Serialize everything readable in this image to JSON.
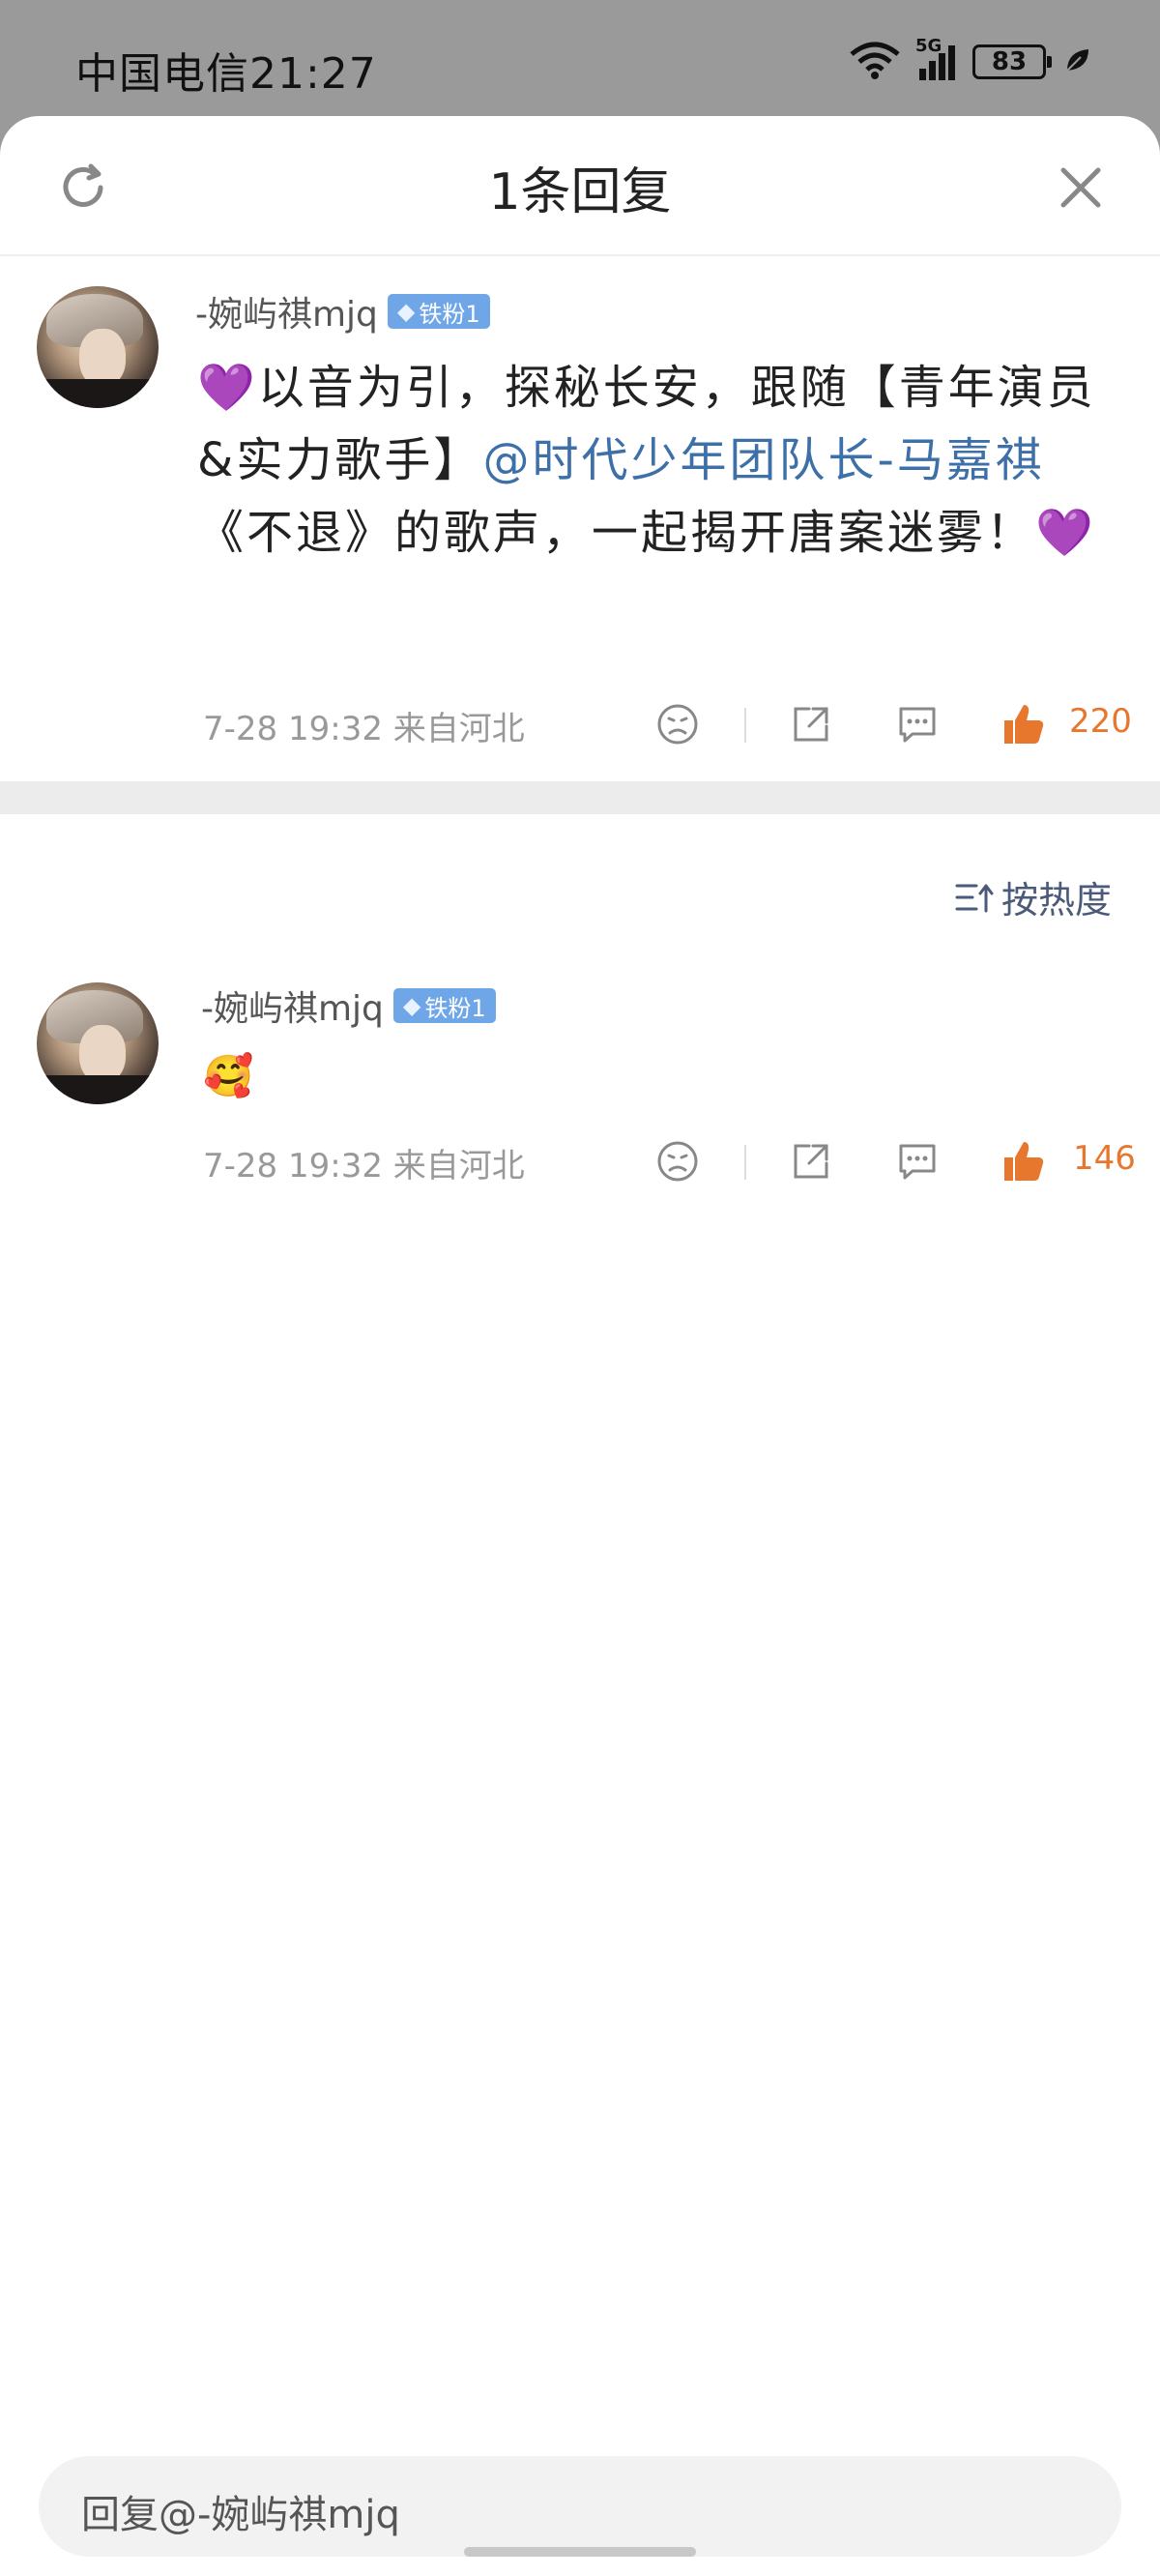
{
  "status_bar": {
    "carrier_time": "中国电信21:27",
    "network": "5G",
    "battery": "83"
  },
  "sheet": {
    "title": "1条回复"
  },
  "main_comment": {
    "username": "-婉屿祺mjq",
    "badge": "铁粉1",
    "text_prefix": "💜以音为引，探秘长安，跟随【青年演员&实力歌手】",
    "mention": "@时代少年团队长-马嘉祺",
    "text_suffix": "《不退》的歌声，一起揭开唐案迷雾！💜",
    "time_location": "7-28 19:32 来自河北",
    "likes": "220"
  },
  "sort": {
    "label": "按热度"
  },
  "reply": {
    "username": "-婉屿祺mjq",
    "badge": "铁粉1",
    "emoji": "🥰",
    "time_location": "7-28 19:32 来自河北",
    "likes": "146"
  },
  "reply_input": {
    "placeholder": "回复@-婉屿祺mjq"
  },
  "colors": {
    "accent_like": "#e8772e",
    "mention": "#3d6fa8",
    "badge": "#6fa6e8"
  }
}
